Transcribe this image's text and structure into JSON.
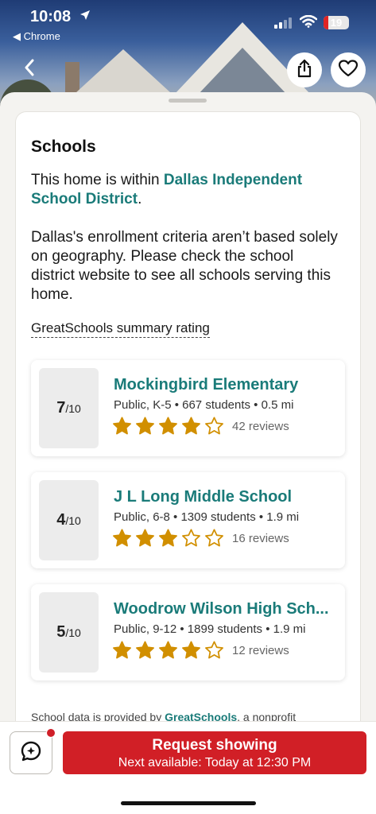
{
  "status_bar": {
    "time": "10:08",
    "back_app": "◀ Chrome",
    "battery": "19",
    "battery_level": 0.19
  },
  "hero": {
    "back_icon": "chevron-left-icon",
    "share_icon": "share-icon",
    "favorite_icon": "heart-icon"
  },
  "schools_section": {
    "title": "Schools",
    "intro_prefix": "This home is within ",
    "district_link": "Dallas Independent School District",
    "intro_suffix": ".",
    "criteria_text": "Dallas's enrollment criteria aren’t based solely on geography. Please check the school district website to see all schools serving this home.",
    "rating_label": "GreatSchools summary rating",
    "schools": [
      {
        "score": "7",
        "score_max": "/10",
        "name": "Mockingbird Elementary",
        "meta": "Public, K-5 • 667 students • 0.5 mi",
        "rating": 4,
        "reviews": "42 reviews"
      },
      {
        "score": "4",
        "score_max": "/10",
        "name": "J L Long Middle School",
        "meta": "Public, 6-8 • 1309 students • 1.9 mi",
        "rating": 3,
        "reviews": "16 reviews"
      },
      {
        "score": "5",
        "score_max": "/10",
        "name": "Woodrow Wilson High Sch...",
        "meta": "Public, 9-12 • 1899 students • 1.9 mi",
        "rating": 4,
        "reviews": "12 reviews"
      }
    ],
    "footnote_prefix": "School data is provided by ",
    "footnote_link": "GreatSchools",
    "footnote_suffix": ", a nonprofit"
  },
  "bottom_bar": {
    "chat_icon": "chat-sparkle-icon",
    "request_label": "Request showing",
    "next_available": "Next available: Today at 12:30 PM"
  },
  "colors": {
    "accent_teal": "#1a7b79",
    "star_gold": "#d18f00",
    "cta_red": "#d11f26"
  }
}
